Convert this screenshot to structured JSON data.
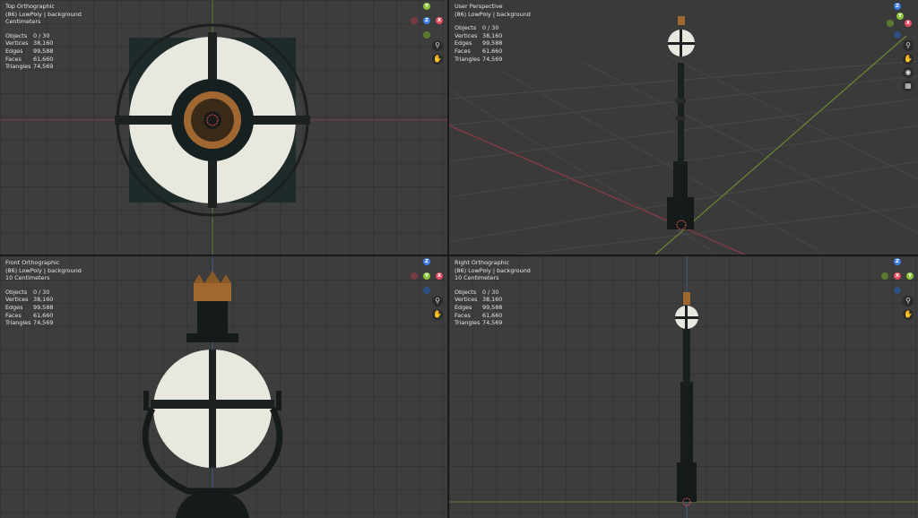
{
  "colors": {
    "axis_x": "#e84a5f",
    "axis_y": "#8bc43a",
    "axis_z": "#3d7de8",
    "grid": "#353535",
    "viewport_bg": "#3d3d3d",
    "brass": "#b0753a",
    "glass": "#eceae0"
  },
  "stat_labels": {
    "objects": "Objects",
    "vertices": "Vertices",
    "edges": "Edges",
    "faces": "Faces",
    "triangles": "Triangles"
  },
  "viewports": {
    "top": {
      "title": "Top Orthographic",
      "collection": "(86) LowPoly | background",
      "units": "Centimeters",
      "stats": {
        "objects": "0 / 30",
        "vertices": "38,160",
        "edges": "99,588",
        "faces": "61,660",
        "triangles": "74,569"
      },
      "gizmo": {
        "up": "Y",
        "center": "Z",
        "right": "X"
      }
    },
    "persp": {
      "title": "User Perspective",
      "collection": "(86) LowPoly | background",
      "units": "",
      "stats": {
        "objects": "0 / 30",
        "vertices": "38,160",
        "edges": "99,588",
        "faces": "61,660",
        "triangles": "74,569"
      },
      "gizmo": {
        "up": "Z",
        "center": "Y",
        "right": "X"
      }
    },
    "front": {
      "title": "Front Orthographic",
      "collection": "(86) LowPoly | background",
      "units": "10 Centimeters",
      "stats": {
        "objects": "0 / 30",
        "vertices": "38,160",
        "edges": "99,588",
        "faces": "61,660",
        "triangles": "74,569"
      },
      "gizmo": {
        "up": "Z",
        "center": "Y",
        "right": "X"
      }
    },
    "right": {
      "title": "Right Orthographic",
      "collection": "(86) LowPoly | background",
      "units": "10 Centimeters",
      "stats": {
        "objects": "0 / 30",
        "vertices": "38,160",
        "edges": "99,588",
        "faces": "61,660",
        "triangles": "74,569"
      },
      "gizmo": {
        "up": "Z",
        "center": "X",
        "right": "Y"
      }
    }
  },
  "icons": {
    "zoom": "magnifier-icon",
    "pan": "hand-icon",
    "camera": "camera-icon",
    "ortho": "grid-icon"
  }
}
